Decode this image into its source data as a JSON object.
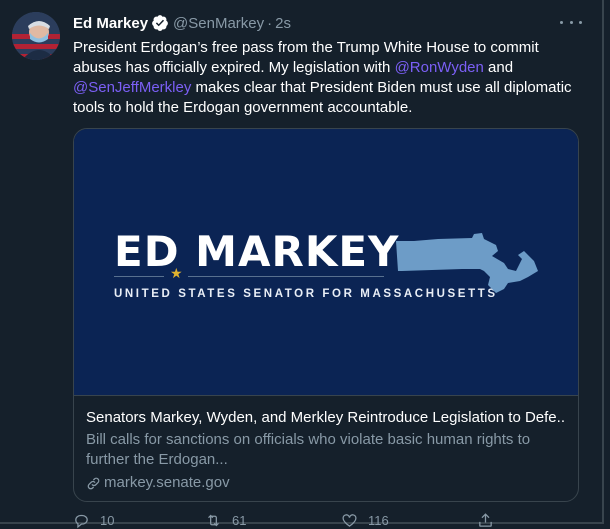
{
  "tweet": {
    "author_name": "Ed Markey",
    "handle": "@SenMarkey",
    "separator": "·",
    "time": "2s",
    "text_before": "President Erdogan’s free pass from the Trump White House to commit abuses has officially expired. My legislation with ",
    "mention_1": "@RonWyden",
    "text_middle": " and ",
    "mention_2": "@SenJeffMerkley",
    "text_after": "  makes clear that President Biden must use all diplomatic tools to hold the Erdogan government accountable."
  },
  "card": {
    "image_title": "ED MARKEY",
    "image_subtitle": "UNITED STATES SENATOR FOR MASSACHUSETTS",
    "title": "Senators Markey, Wyden, and Merkley Reintroduce Legislation to Defe...",
    "description": "Bill calls for sanctions on officials who violate basic human rights to further the Erdogan...",
    "domain": "markey.senate.gov",
    "brand_color": "#0b2454",
    "state_color": "#6d9cc7",
    "star_color": "#e1b32f"
  },
  "actions": {
    "reply_count": "10",
    "retweet_count": "61",
    "like_count": "116"
  },
  "icons": [
    "verified-badge-icon",
    "more-options-icon",
    "link-icon",
    "reply-icon",
    "retweet-icon",
    "like-icon",
    "share-icon"
  ]
}
